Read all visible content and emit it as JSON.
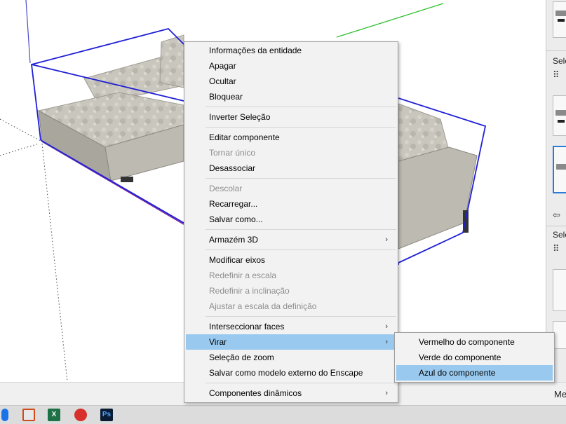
{
  "context_menu": {
    "items": [
      {
        "label": "Informações da entidade",
        "enabled": true
      },
      {
        "label": "Apagar",
        "enabled": true
      },
      {
        "label": "Ocultar",
        "enabled": true
      },
      {
        "label": "Bloquear",
        "enabled": true
      },
      {
        "label": "Inverter Seleção",
        "enabled": true
      },
      {
        "label": "Editar componente",
        "enabled": true
      },
      {
        "label": "Tornar único",
        "enabled": false
      },
      {
        "label": "Desassociar",
        "enabled": true
      },
      {
        "label": "Descolar",
        "enabled": false
      },
      {
        "label": "Recarregar...",
        "enabled": true
      },
      {
        "label": "Salvar como...",
        "enabled": true
      },
      {
        "label": "Armazém 3D",
        "enabled": true,
        "submenu": true
      },
      {
        "label": "Modificar eixos",
        "enabled": true
      },
      {
        "label": "Redefinir a escala",
        "enabled": false
      },
      {
        "label": "Redefinir a inclinação",
        "enabled": false
      },
      {
        "label": "Ajustar a escala da definição",
        "enabled": false
      },
      {
        "label": "Interseccionar faces",
        "enabled": true,
        "submenu": true
      },
      {
        "label": "Virar",
        "enabled": true,
        "submenu": true,
        "highlighted": true
      },
      {
        "label": "Seleção de zoom",
        "enabled": true
      },
      {
        "label": "Salvar como modelo externo do Enscape",
        "enabled": true
      },
      {
        "label": "Componentes dinâmicos",
        "enabled": true,
        "submenu": true
      }
    ],
    "submenu_arrow": "›"
  },
  "flip_submenu": {
    "items": [
      {
        "label": "Vermelho do componente"
      },
      {
        "label": "Verde do componente"
      },
      {
        "label": "Azul do componente",
        "highlighted": true
      }
    ]
  },
  "tray": {
    "label_1": "Sele",
    "label_2": "Sele",
    "nav_back": "⇦",
    "grid_icon": "⠿"
  },
  "statusbar": {
    "right_text": "Me"
  },
  "taskbar": {
    "apps": [
      "chrome-icon",
      "shield-icon",
      "excel-icon",
      "sketchup-icon",
      "photoshop-icon"
    ],
    "excel_glyph": "X",
    "photoshop_glyph": "Ps"
  },
  "colors": {
    "selection_bbox": "#1f1fd6",
    "axis_green": "#2fbf2f",
    "axis_purple": "#7a2aa8",
    "menu_highlight": "#99c9ef"
  }
}
